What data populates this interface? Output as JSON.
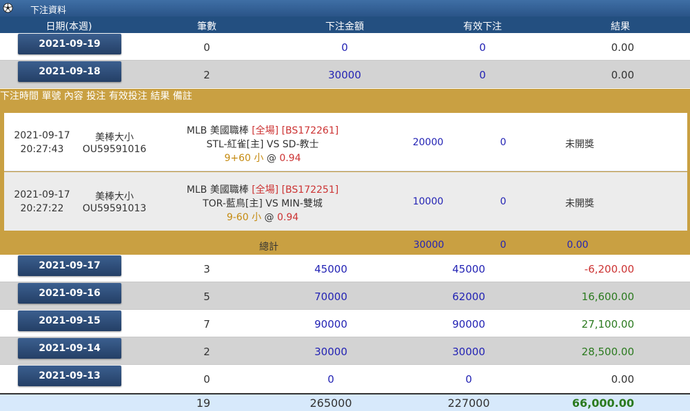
{
  "panel": {
    "title": "下注資料"
  },
  "columns": {
    "date": "日期(本週)",
    "count": "筆數",
    "amount": "下注金額",
    "valid": "有效下注",
    "result": "結果"
  },
  "rows_top": [
    {
      "date": "2021-09-19",
      "count": "0",
      "amount": "0",
      "valid": "0",
      "result": "0.00"
    },
    {
      "date": "2021-09-18",
      "count": "2",
      "amount": "30000",
      "valid": "0",
      "result": "0.00"
    }
  ],
  "detail": {
    "headers": {
      "time": "下注時間",
      "ticket": "單號",
      "content": "內容",
      "stake": "投注",
      "valid": "有效投注",
      "result": "結果",
      "note": "備註"
    },
    "bets": [
      {
        "date": "2021-09-17",
        "time": "20:27:43",
        "type": "美棒大小",
        "ticket": "OU59591016",
        "league": "MLB 美國職棒",
        "scope": "[全場]",
        "code": "[BS172261]",
        "match": "STL-紅雀[主] VS SD-教士",
        "line": "9+60 小",
        "at": "@",
        "odds": "0.94",
        "stake": "20000",
        "valid": "0",
        "result": "未開獎"
      },
      {
        "date": "2021-09-17",
        "time": "20:27:22",
        "type": "美棒大小",
        "ticket": "OU59591013",
        "league": "MLB 美國職棒",
        "scope": "[全場]",
        "code": "[BS172251]",
        "match": "TOR-藍鳥[主] VS MIN-雙城",
        "line": "9-60 小",
        "at": "@",
        "odds": "0.94",
        "stake": "10000",
        "valid": "0",
        "result": "未開獎"
      }
    ],
    "summary": {
      "label": "總計",
      "stake": "30000",
      "valid": "0",
      "result": "0.00"
    }
  },
  "rows_bottom": [
    {
      "date": "2021-09-17",
      "count": "3",
      "amount": "45000",
      "valid": "45000",
      "result": "-6,200.00"
    },
    {
      "date": "2021-09-16",
      "count": "5",
      "amount": "70000",
      "valid": "62000",
      "result": "16,600.00"
    },
    {
      "date": "2021-09-15",
      "count": "7",
      "amount": "90000",
      "valid": "90000",
      "result": "27,100.00"
    },
    {
      "date": "2021-09-14",
      "count": "2",
      "amount": "30000",
      "valid": "30000",
      "result": "28,500.00"
    },
    {
      "date": "2021-09-13",
      "count": "0",
      "amount": "0",
      "valid": "0",
      "result": "0.00"
    }
  ],
  "total": {
    "count": "19",
    "amount": "265000",
    "valid": "227000",
    "result": "66,000.00"
  },
  "colors": {
    "title_bar": "#2a5488",
    "header": "#234f80",
    "gold": "#c9a042",
    "blue_value": "#2323b4",
    "red_value": "#cc3333",
    "green_value": "#2b7a1f",
    "total_bg": "#d7e9fb"
  },
  "icons": {
    "panel": "soccer-ball-icon"
  }
}
